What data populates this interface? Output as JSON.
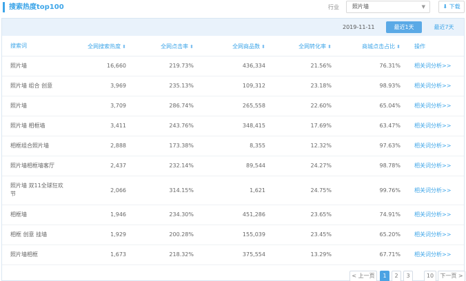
{
  "header": {
    "title": "搜索热度top100",
    "industry_label": "行业",
    "industry_value": "照片墙",
    "download_label": "下载"
  },
  "toolbar": {
    "date": "2019-11-11",
    "btn_7d": "最近1天",
    "btn_30d": "最近7天"
  },
  "table": {
    "headers": {
      "keyword": "搜索词",
      "heat": "全网搜索热度",
      "click": "全网点击率",
      "goods": "全网商品数",
      "conv": "全网转化率",
      "mall": "商城点击占比",
      "op": "操作"
    },
    "rows": [
      {
        "kw": "照片墙",
        "heat": "16,660",
        "click": "219.73%",
        "goods": "436,334",
        "conv": "21.56%",
        "mall": "76.31%",
        "op": "相关词分析>>"
      },
      {
        "kw": "照片墙 组合 创意",
        "heat": "3,969",
        "click": "235.13%",
        "goods": "109,312",
        "conv": "23.18%",
        "mall": "98.93%",
        "op": "相关词分析>>"
      },
      {
        "kw": "照片墙",
        "heat": "3,709",
        "click": "286.74%",
        "goods": "265,558",
        "conv": "22.60%",
        "mall": "65.04%",
        "op": "相关词分析>>"
      },
      {
        "kw": "照片墙 相框墙",
        "heat": "3,411",
        "click": "243.76%",
        "goods": "348,415",
        "conv": "17.69%",
        "mall": "63.47%",
        "op": "相关词分析>>"
      },
      {
        "kw": "相框组合照片墙",
        "heat": "2,888",
        "click": "173.38%",
        "goods": "8,355",
        "conv": "12.32%",
        "mall": "97.63%",
        "op": "相关词分析>>"
      },
      {
        "kw": "照片墙相框墙客厅",
        "heat": "2,437",
        "click": "232.14%",
        "goods": "89,544",
        "conv": "24.27%",
        "mall": "98.78%",
        "op": "相关词分析>>"
      },
      {
        "kw": "照片墙 双11全球狂欢节",
        "heat": "2,066",
        "click": "314.15%",
        "goods": "1,621",
        "conv": "24.75%",
        "mall": "99.76%",
        "op": "相关词分析>>",
        "tall": true
      },
      {
        "kw": "相框墙",
        "heat": "1,946",
        "click": "234.30%",
        "goods": "451,286",
        "conv": "23.65%",
        "mall": "74.91%",
        "op": "相关词分析>>"
      },
      {
        "kw": "相框 创意 挂墙",
        "heat": "1,929",
        "click": "200.28%",
        "goods": "155,039",
        "conv": "23.45%",
        "mall": "65.20%",
        "op": "相关词分析>>"
      },
      {
        "kw": "照片墙相框",
        "heat": "1,673",
        "click": "218.32%",
        "goods": "375,554",
        "conv": "13.29%",
        "mall": "67.71%",
        "op": "相关词分析>>"
      }
    ]
  },
  "pager": {
    "prev": "< 上一页",
    "pages": [
      "1",
      "2",
      "3"
    ],
    "jump": "10",
    "next": "下一页 >"
  },
  "icons": {
    "sort": "sort-icon",
    "caret": "chevron-down-icon",
    "download": "download-icon"
  },
  "colors": {
    "accent": "#3da5e8",
    "toolbar_bg": "#e9f2fb",
    "active_btn": "#5aa9e6"
  }
}
